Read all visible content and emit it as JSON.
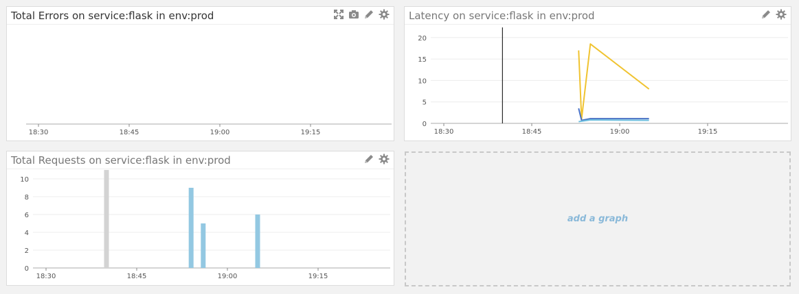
{
  "panels": {
    "errors": {
      "title": "Total Errors on service:flask in env:prod",
      "chart_data": {
        "type": "bar",
        "title": "Total Errors on service:flask in env:prod",
        "x_ticks": [
          "18:30",
          "18:45",
          "19:00",
          "19:15"
        ],
        "series": []
      }
    },
    "latency": {
      "title": "Latency on service:flask in env:prod",
      "chart_data": {
        "type": "line",
        "title": "Latency on service:flask in env:prod",
        "x_ticks": [
          "18:30",
          "18:45",
          "19:00",
          "19:15"
        ],
        "y_ticks": [
          "0",
          "5",
          "10",
          "15",
          "20"
        ],
        "ylim": [
          0,
          23
        ],
        "xlim_minutes": [
          "18:25",
          "19:29"
        ],
        "marker_time": "18:40",
        "series": [
          {
            "color": "#f0c330",
            "points": [
              [
                "18:53",
                17
              ],
              [
                "18:53.5",
                1
              ],
              [
                "18:55",
                18.5
              ],
              [
                "19:05",
                8
              ]
            ]
          },
          {
            "color": "#4a72c4",
            "points": [
              [
                "18:53",
                3.5
              ],
              [
                "18:53.5",
                0.7
              ],
              [
                "18:55",
                1.1
              ],
              [
                "19:05",
                1.1
              ]
            ]
          },
          {
            "color": "#6fbfdf",
            "points": [
              [
                "18:53",
                0.4
              ],
              [
                "18:55",
                0.8
              ],
              [
                "19:05",
                0.7
              ]
            ]
          }
        ]
      }
    },
    "requests": {
      "title": "Total Requests on service:flask in env:prod",
      "chart_data": {
        "type": "bar",
        "title": "Total Requests on service:flask in env:prod",
        "x_ticks": [
          "18:30",
          "18:45",
          "19:00",
          "19:15"
        ],
        "y_ticks": [
          "0",
          "2",
          "4",
          "6",
          "8",
          "10"
        ],
        "ylim": [
          0,
          11
        ],
        "bars": [
          {
            "time": "18:40",
            "value": 11,
            "color": "#d3d3d3"
          },
          {
            "time": "18:54",
            "value": 9,
            "color": "#93c8e2"
          },
          {
            "time": "18:56",
            "value": 5,
            "color": "#93c8e2"
          },
          {
            "time": "19:05",
            "value": 6,
            "color": "#93c8e2"
          }
        ]
      }
    }
  },
  "add_graph": {
    "label": "add a graph"
  },
  "icons": {
    "expand": "expand-icon",
    "camera": "camera-icon",
    "edit": "pencil-icon",
    "settings": "gear-icon"
  },
  "colors": {
    "icon": "#8a8a8a",
    "link": "#8ab9d9"
  }
}
